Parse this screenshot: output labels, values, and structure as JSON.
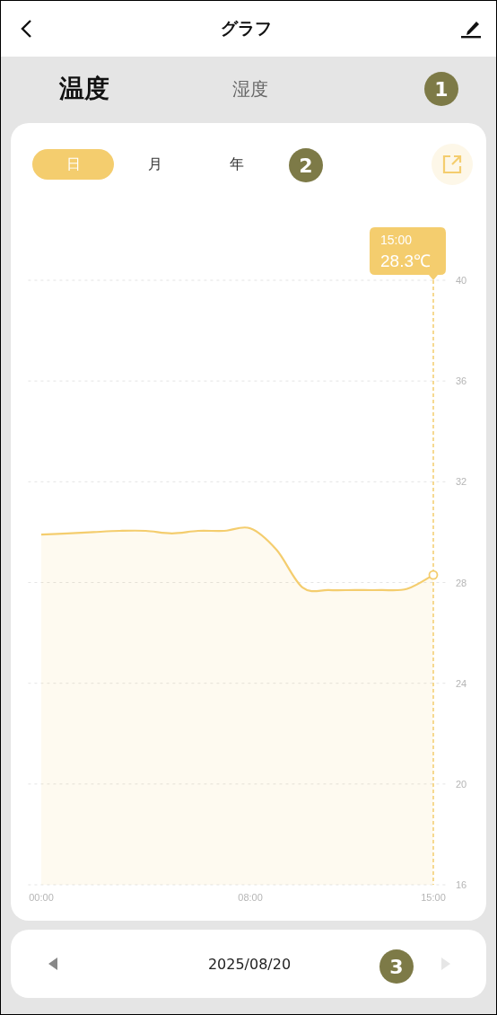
{
  "header": {
    "title": "グラフ"
  },
  "tabs": [
    {
      "label": "温度",
      "selected": true
    },
    {
      "label": "湿度",
      "selected": false
    }
  ],
  "periods": [
    {
      "label": "日",
      "selected": true
    },
    {
      "label": "月",
      "selected": false
    },
    {
      "label": "年",
      "selected": false
    }
  ],
  "chart_data": {
    "type": "area",
    "x": [
      0,
      1,
      2,
      3,
      4,
      5,
      6,
      7,
      8,
      9,
      10,
      11,
      12,
      13,
      14,
      15
    ],
    "series": [
      {
        "color": "#f4cd6e",
        "values": [
          29.9,
          29.95,
          30.0,
          30.05,
          30.05,
          29.95,
          30.05,
          30.05,
          30.15,
          29.3,
          27.8,
          27.7,
          27.7,
          27.7,
          27.75,
          28.3
        ]
      }
    ],
    "xlim": [
      -0.5,
      15.6
    ],
    "ylim": [
      16,
      40
    ],
    "grid": true,
    "xticks": [
      {
        "value": 0,
        "label": "00:00"
      },
      {
        "value": 8,
        "label": "08:00"
      },
      {
        "value": 15,
        "label": "15:00"
      }
    ],
    "yticks": [
      16,
      20,
      24,
      28,
      32,
      36,
      40
    ],
    "ref_lines": [
      {
        "axis": "x",
        "value": 15
      }
    ]
  },
  "tooltip": {
    "time": "15:00",
    "value": "28.3℃"
  },
  "date_nav": {
    "date": "2025/08/20",
    "previous_disabled": false,
    "next_disabled": true
  },
  "markers": [
    "1",
    "2",
    "3"
  ]
}
